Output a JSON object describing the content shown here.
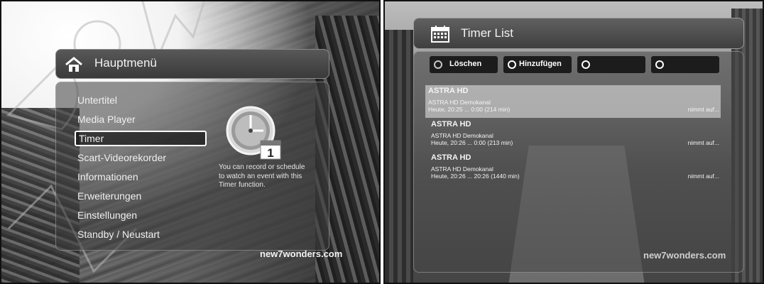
{
  "left_screen": {
    "menu_title": "Hauptmenü",
    "menu_items": [
      {
        "label": "Untertitel"
      },
      {
        "label": "Media Player"
      },
      {
        "label": "Timer"
      },
      {
        "label": "Scart-Videorekorder"
      },
      {
        "label": "Informationen"
      },
      {
        "label": "Erweiterungen"
      },
      {
        "label": "Einstellungen"
      },
      {
        "label": "Standby / Neustart"
      }
    ],
    "selected_item": "Timer",
    "calendar_day": "1",
    "help_text": "You can record or schedule to watch an event with this Timer function.",
    "brand": "new7wonders.com"
  },
  "right_screen": {
    "title": "Timer List",
    "buttons": [
      {
        "label": "Löschen",
        "ring": "grey"
      },
      {
        "label": "Hinzufügen",
        "ring": "white"
      },
      {
        "label": "",
        "ring": "white"
      },
      {
        "label": "",
        "ring": "white"
      }
    ],
    "timers": [
      {
        "name": "ASTRA HD",
        "channel": "ASTRA HD Demokanal",
        "time": "Heute, 20:25 ... 0:00 (214 min)",
        "status": "nimmt auf..."
      },
      {
        "name": "ASTRA HD",
        "channel": "ASTRA HD Demokanal",
        "time": "Heute, 20:26 ... 0:00 (213 min)",
        "status": "nimmt auf..."
      },
      {
        "name": "ASTRA HD",
        "channel": "ASTRA HD Demokanal",
        "time": "Heute, 20:26 ... 20:26 (1440 min)",
        "status": "nimmt auf..."
      }
    ],
    "brand": "new7wonders.com"
  }
}
